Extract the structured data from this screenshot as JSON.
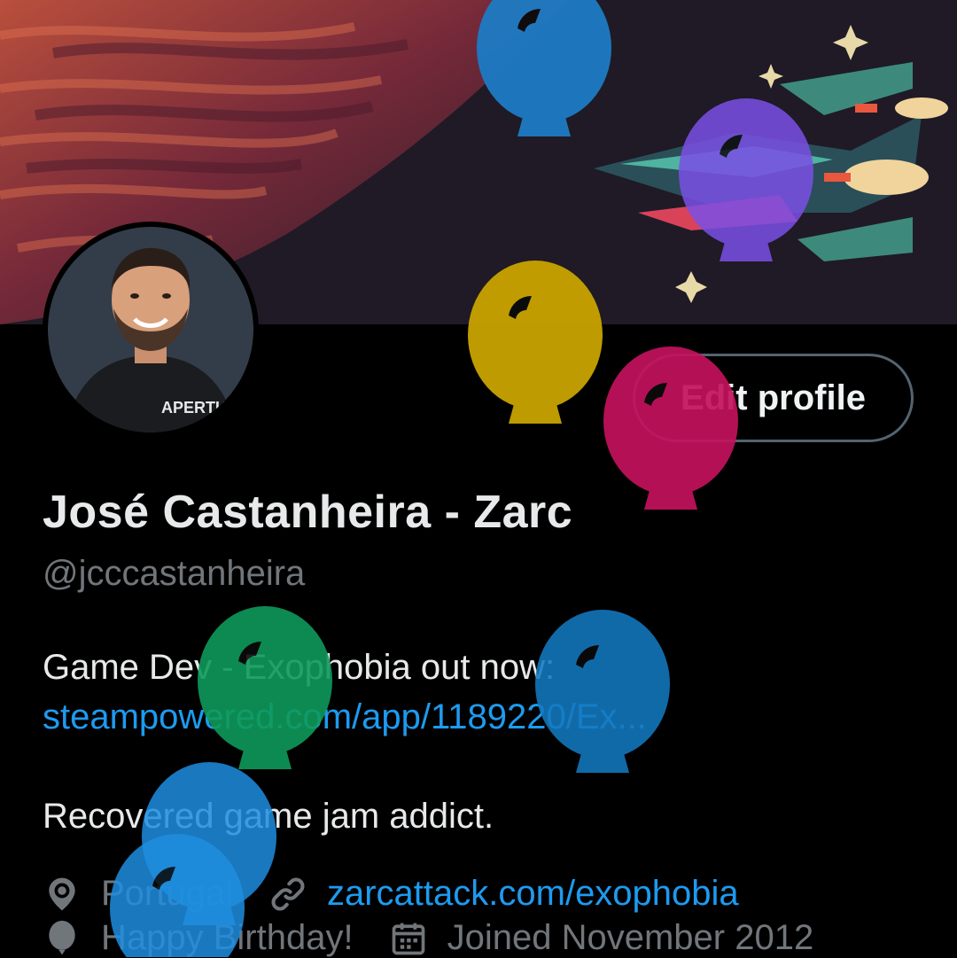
{
  "profile": {
    "display_name": "José Castanheira - Zarc",
    "handle": "@jcccastanheira",
    "edit_button_label": "Edit profile",
    "avatar_shirt_text": "APERTURE",
    "bio": {
      "line1": "Game Dev - Exophobia out now:",
      "link": "steampowered.com/app/1189220/Ex...",
      "line3": "Recovered game jam addict."
    },
    "location": "Portugal",
    "website": "zarcattack.com/exophobia",
    "birthday": "Happy Birthday!",
    "joined": "Joined November 2012"
  },
  "icons": {
    "location": "location-pin-icon",
    "website": "link-icon",
    "birthday": "balloon-icon",
    "joined": "calendar-icon"
  },
  "colors": {
    "background": "#000000",
    "text": "#e7e9ea",
    "secondary_text": "#71767b",
    "link": "#1d9bf0",
    "button_border": "#536471"
  },
  "balloon_colors": [
    "#1d7bc4",
    "#7b4fe6",
    "#c9a400",
    "#c4125e",
    "#0f9a5a",
    "#1479c0",
    "#1f8ee0"
  ]
}
